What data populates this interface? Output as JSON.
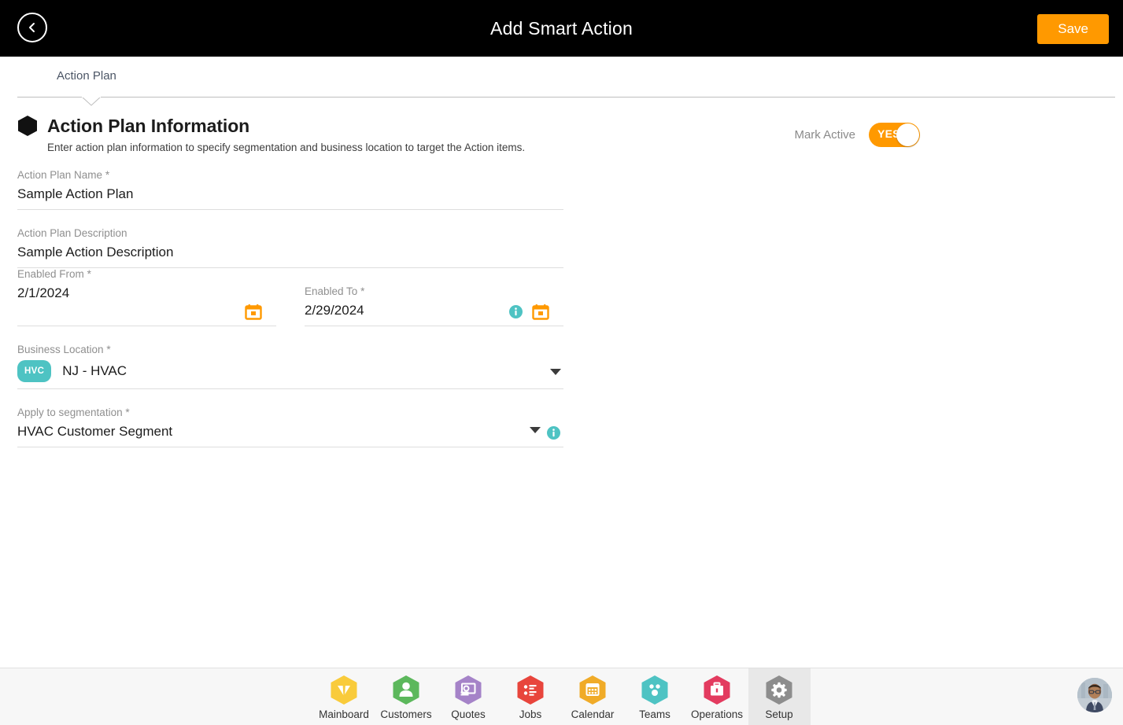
{
  "header": {
    "title": "Add Smart Action",
    "back_icon": "chevron-left-circle-icon",
    "save_label": "Save",
    "save_color": "#ff9900"
  },
  "tabs": [
    {
      "label": "Action Plan",
      "active": true
    }
  ],
  "section": {
    "title": "Action Plan Information",
    "subtitle": "Enter action plan information to specify segmentation and business location to target the Action items.",
    "marker_icon": "hexagon-icon"
  },
  "mark_active": {
    "label": "Mark Active",
    "toggle_value": "YES",
    "toggle_on": true,
    "toggle_color": "#ff9900"
  },
  "form": {
    "action_plan_name": {
      "label": "Action Plan Name",
      "required": "*",
      "value": "Sample Action Plan"
    },
    "action_plan_description": {
      "label": "Action Plan Description",
      "required": "",
      "value": "Sample Action Description"
    },
    "enabled_from": {
      "label": "Enabled From",
      "required": "*",
      "value": "2/1/2024",
      "icon": "calendar-icon"
    },
    "enabled_to": {
      "label": "Enabled To",
      "required": "*",
      "value": "2/29/2024",
      "icon": "calendar-icon",
      "info_icon": "info-icon"
    },
    "business_location": {
      "label": "Business Location",
      "required": "*",
      "badge": "HVC",
      "badge_color": "#4ec3c3",
      "value": "NJ - HVAC",
      "caret": "chevron-down-icon"
    },
    "apply_to_segmentation": {
      "label": "Apply to segmentation",
      "required": "*",
      "value": "HVAC Customer Segment",
      "caret": "chevron-down-icon",
      "info_icon": "info-icon"
    }
  },
  "bottom_nav": {
    "items": [
      {
        "label": "Mainboard",
        "icon": "mainboard-icon",
        "color": "#f9cb3b",
        "active": false
      },
      {
        "label": "Customers",
        "icon": "person-icon",
        "color": "#5cb85c",
        "active": false
      },
      {
        "label": "Quotes",
        "icon": "quotes-icon",
        "color": "#a583c8",
        "active": false
      },
      {
        "label": "Jobs",
        "icon": "checklist-icon",
        "color": "#e8453c",
        "active": false
      },
      {
        "label": "Calendar",
        "icon": "calendar-icon",
        "color": "#f0ab28",
        "active": false
      },
      {
        "label": "Teams",
        "icon": "teams-icon",
        "color": "#4ec3c3",
        "active": false
      },
      {
        "label": "Operations",
        "icon": "briefcase-icon",
        "color": "#e33b5f",
        "active": false
      },
      {
        "label": "Setup",
        "icon": "gear-icon",
        "color": "#8d8d8d",
        "active": true
      }
    ],
    "avatar": "user-avatar"
  }
}
